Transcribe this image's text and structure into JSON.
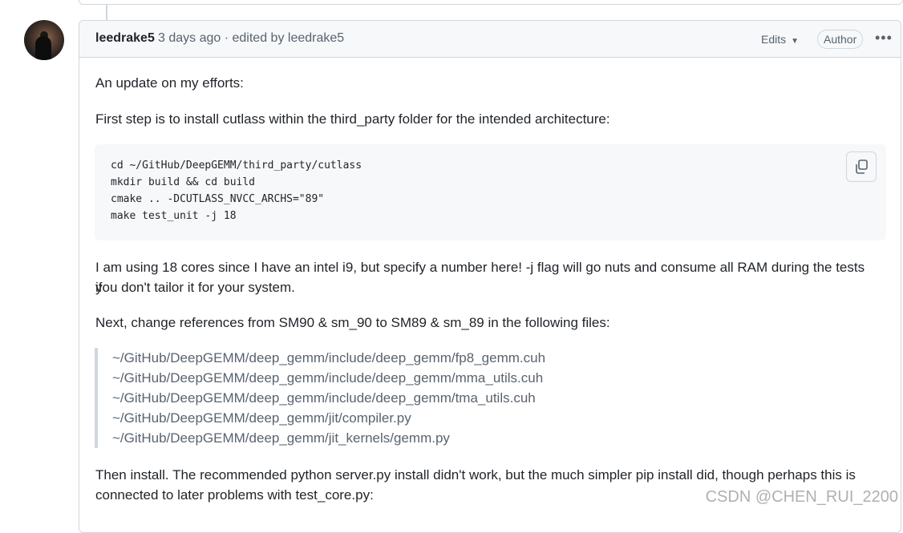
{
  "comment": {
    "author": "leedrake5",
    "meta": "3 days ago · edited by leedrake5",
    "edits_label": "Edits",
    "author_badge": "Author",
    "menu_icon": "kebab-horizontal-icon"
  },
  "body": {
    "p1": "An update on my efforts:",
    "p2": "First step is to install cutlass within the third_party folder for the intended architecture:",
    "code": {
      "lines": [
        "cd ~/GitHub/DeepGEMM/third_party/cutlass",
        "mkdir build && cd build",
        "cmake .. -DCUTLASS_NVCC_ARCHS=\"89\"",
        "make test_unit -j 18"
      ],
      "copy_icon": "copy-icon"
    },
    "p3_line1": "I am using 18 cores since I have an intel i9, but specify a number here! -j flag will go nuts and consume all RAM during the tests if",
    "p3_line2": "you don't tailor it for your system.",
    "p4": "Next, change references from SM90 & sm_90 to SM89 & sm_89 in the following files:",
    "files": [
      "~/GitHub/DeepGEMM/deep_gemm/include/deep_gemm/fp8_gemm.cuh",
      "~/GitHub/DeepGEMM/deep_gemm/include/deep_gemm/mma_utils.cuh",
      "~/GitHub/DeepGEMM/deep_gemm/include/deep_gemm/tma_utils.cuh",
      "~/GitHub/DeepGEMM/deep_gemm/jit/compiler.py",
      "~/GitHub/DeepGEMM/deep_gemm/jit_kernels/gemm.py"
    ],
    "p5_line1": "Then install. The recommended python server.py install didn't work, but the much simpler pip install did, though perhaps this is",
    "p5_line2": "connected to later problems with test_core.py:"
  },
  "watermark": "CSDN @CHEN_RUI_2200"
}
